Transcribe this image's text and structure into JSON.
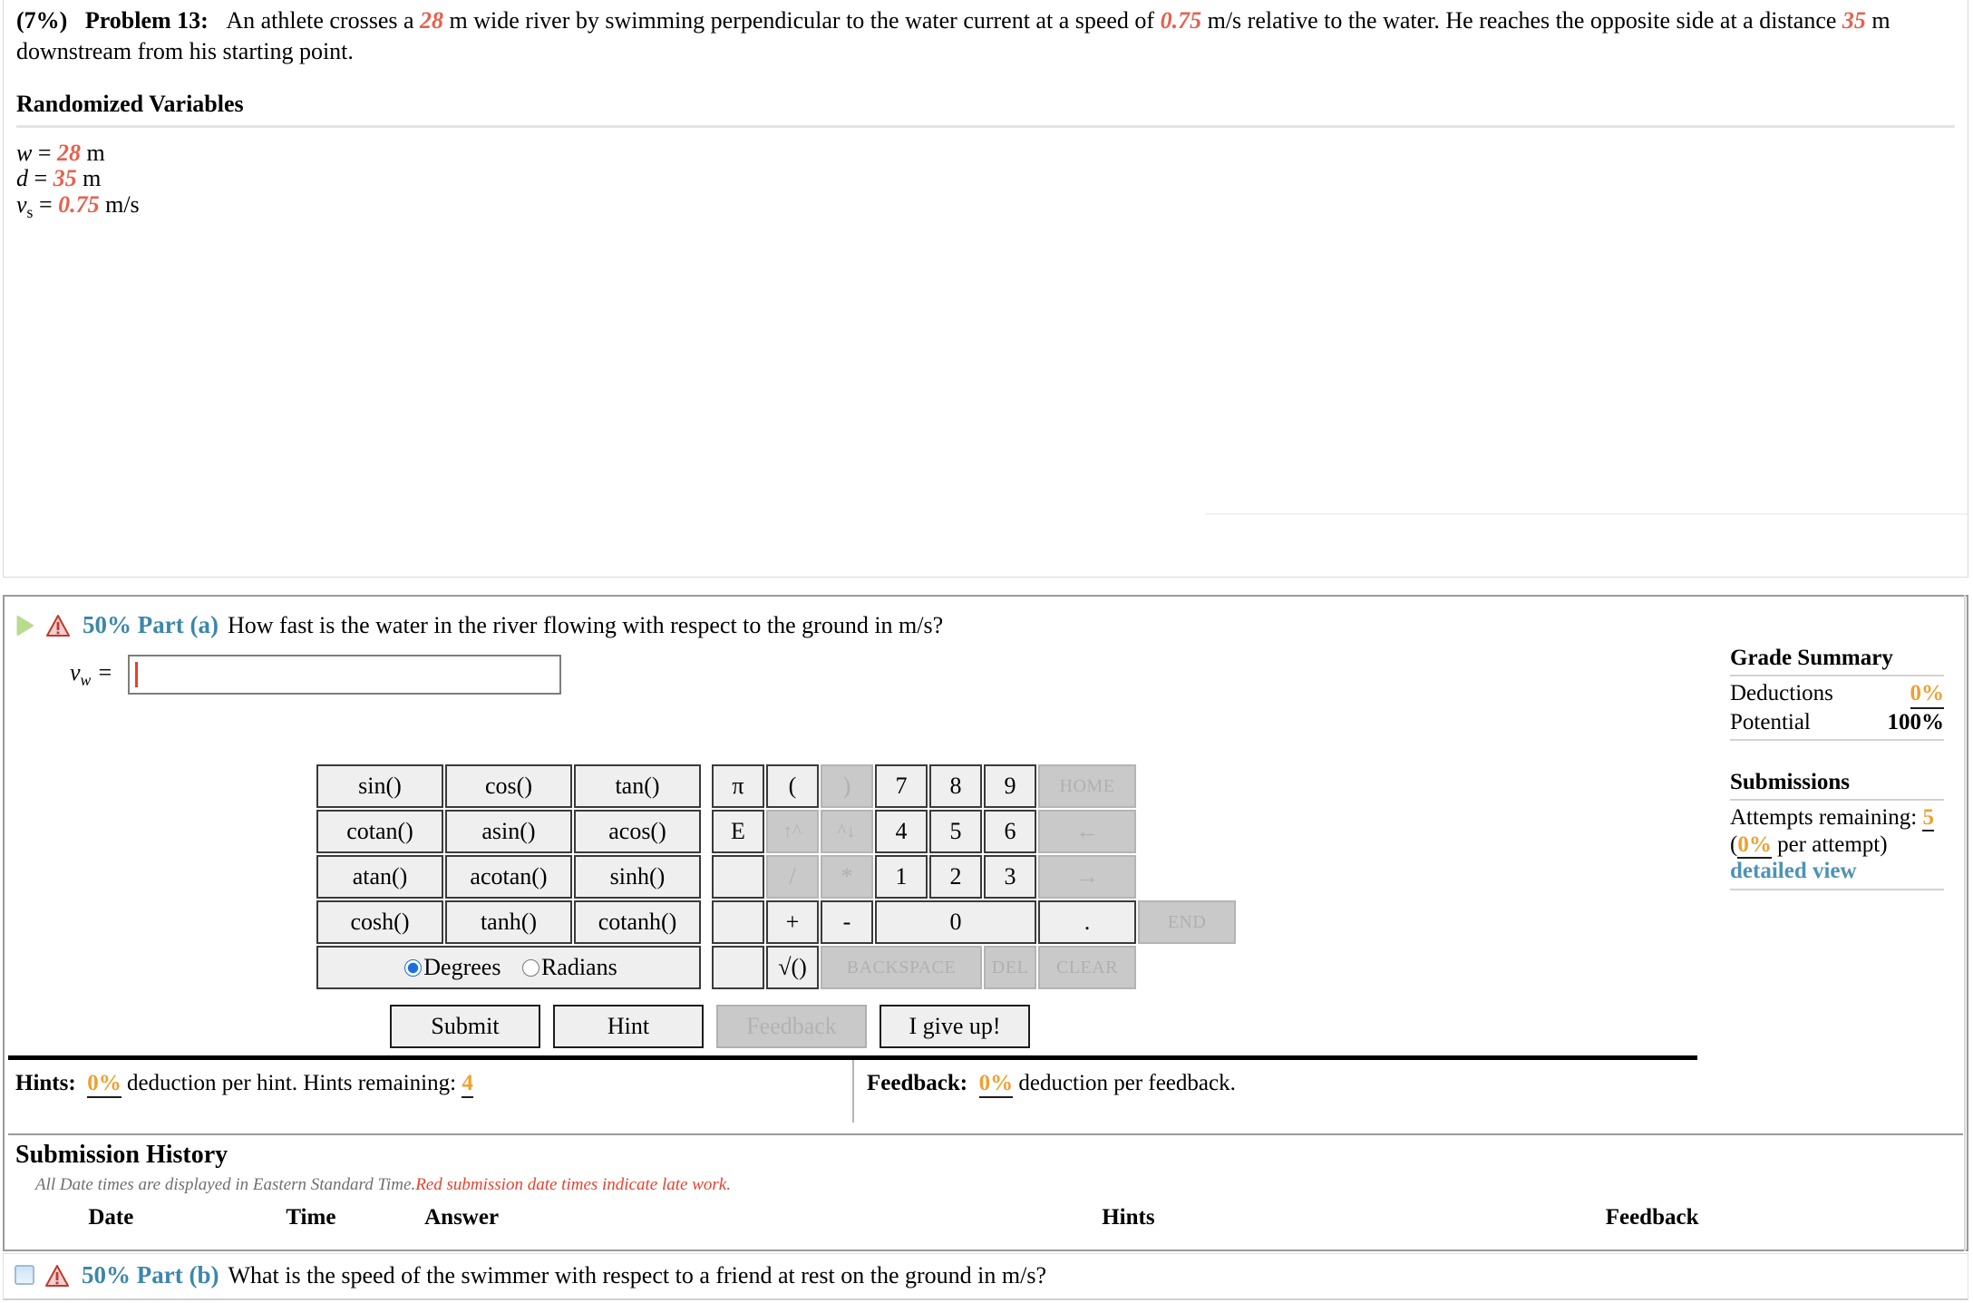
{
  "problem": {
    "percent": "(7%)",
    "label": "Problem 13:",
    "text_1": "An athlete crosses a ",
    "val_width": "28",
    "text_2": " m wide river by swimming perpendicular to the water current at a speed of ",
    "val_speed": "0.75",
    "text_3": " m/s relative to the water. He reaches the opposite side at a distance ",
    "val_dist": "35",
    "text_4": " m downstream from his starting point."
  },
  "randomized": {
    "heading": "Randomized Variables",
    "rows": [
      {
        "sym": "w",
        "sub": "",
        "eq": " = ",
        "val": "28",
        "unit": " m"
      },
      {
        "sym": "d",
        "sub": "",
        "eq": " = ",
        "val": "35",
        "unit": " m"
      },
      {
        "sym": "v",
        "sub": "s",
        "eq": " = ",
        "val": "0.75",
        "unit": " m/s"
      }
    ]
  },
  "part_a": {
    "icon_play": "play-icon",
    "icon_warning": "warning-icon",
    "percent": "50% Part (a)",
    "question": "How fast is the water in the river flowing with respect to the ground in m/s?",
    "answer_label_sym": "v",
    "answer_label_sub": "w",
    "answer_label_eq": " = ",
    "answer_value": "",
    "answer_placeholder": ""
  },
  "keypad": {
    "functions": [
      [
        "sin()",
        "cos()",
        "tan()"
      ],
      [
        "cotan()",
        "asin()",
        "acos()"
      ],
      [
        "atan()",
        "acotan()",
        "sinh()"
      ],
      [
        "cosh()",
        "tanh()",
        "cotanh()"
      ]
    ],
    "angle_modes": [
      {
        "label": "Degrees",
        "selected": true
      },
      {
        "label": "Radians",
        "selected": false
      }
    ],
    "rows": [
      [
        {
          "label": "π",
          "name": "pi-key",
          "enabled": true,
          "span": 1,
          "cls": ""
        },
        {
          "label": "(",
          "name": "open-paren-key",
          "enabled": true,
          "span": 1,
          "cls": ""
        },
        {
          "label": ")",
          "name": "close-paren-key",
          "enabled": false,
          "span": 1,
          "cls": ""
        },
        {
          "label": "7",
          "name": "key-7",
          "enabled": true,
          "span": 1,
          "cls": "num"
        },
        {
          "label": "8",
          "name": "key-8",
          "enabled": true,
          "span": 1,
          "cls": "num"
        },
        {
          "label": "9",
          "name": "key-9",
          "enabled": true,
          "span": 1,
          "cls": "num"
        },
        {
          "label": "HOME",
          "name": "home-key",
          "enabled": false,
          "span": 1,
          "cls": "home small"
        }
      ],
      [
        {
          "label": "E",
          "name": "exponent-key",
          "enabled": true,
          "span": 1,
          "cls": ""
        },
        {
          "label": "↑^",
          "name": "superscript-key",
          "enabled": false,
          "span": 1,
          "cls": "small"
        },
        {
          "label": "^↓",
          "name": "subscript-key",
          "enabled": false,
          "span": 1,
          "cls": "small"
        },
        {
          "label": "4",
          "name": "key-4",
          "enabled": true,
          "span": 1,
          "cls": "num"
        },
        {
          "label": "5",
          "name": "key-5",
          "enabled": true,
          "span": 1,
          "cls": "num"
        },
        {
          "label": "6",
          "name": "key-6",
          "enabled": true,
          "span": 1,
          "cls": "num"
        },
        {
          "label": "←",
          "name": "arrow-left-key",
          "enabled": false,
          "span": 1,
          "cls": "home"
        }
      ],
      [
        {
          "label": "",
          "name": "blank-key-1",
          "enabled": true,
          "span": 1,
          "cls": "blank"
        },
        {
          "label": "/",
          "name": "divide-key",
          "enabled": false,
          "span": 1,
          "cls": ""
        },
        {
          "label": "*",
          "name": "multiply-key",
          "enabled": false,
          "span": 1,
          "cls": ""
        },
        {
          "label": "1",
          "name": "key-1",
          "enabled": true,
          "span": 1,
          "cls": "num"
        },
        {
          "label": "2",
          "name": "key-2",
          "enabled": true,
          "span": 1,
          "cls": "num"
        },
        {
          "label": "3",
          "name": "key-3",
          "enabled": true,
          "span": 1,
          "cls": "num"
        },
        {
          "label": "→",
          "name": "arrow-right-key",
          "enabled": false,
          "span": 1,
          "cls": "home"
        }
      ],
      [
        {
          "label": "",
          "name": "blank-key-2",
          "enabled": true,
          "span": 1,
          "cls": "blank"
        },
        {
          "label": "+",
          "name": "plus-key",
          "enabled": true,
          "span": 1,
          "cls": ""
        },
        {
          "label": "-",
          "name": "minus-key",
          "enabled": true,
          "span": 1,
          "cls": ""
        },
        {
          "label": "0",
          "name": "key-0",
          "enabled": true,
          "span": 3,
          "cls": ""
        },
        {
          "label": ".",
          "name": "decimal-key",
          "enabled": true,
          "span": 1,
          "cls": "num"
        },
        {
          "label": "END",
          "name": "end-key",
          "enabled": false,
          "span": 1,
          "cls": "home small"
        }
      ],
      [
        {
          "label": "",
          "name": "blank-key-3",
          "enabled": true,
          "span": 1,
          "cls": "blank"
        },
        {
          "label": "√()",
          "name": "sqrt-key",
          "enabled": true,
          "span": 1,
          "cls": ""
        },
        {
          "label": "BACKSPACE",
          "name": "backspace-key",
          "enabled": false,
          "span": 3,
          "cls": "small"
        },
        {
          "label": "DEL",
          "name": "delete-key",
          "enabled": false,
          "span": 1,
          "cls": "small"
        },
        {
          "label": "CLEAR",
          "name": "clear-key",
          "enabled": false,
          "span": 1,
          "cls": "home small"
        }
      ]
    ]
  },
  "actions": [
    {
      "label": "Submit",
      "name": "submit-button",
      "enabled": true
    },
    {
      "label": "Hint",
      "name": "hint-button",
      "enabled": true
    },
    {
      "label": "Feedback",
      "name": "feedback-button",
      "enabled": false
    },
    {
      "label": "I give up!",
      "name": "give-up-button",
      "enabled": true
    }
  ],
  "hints_strip": {
    "hints_title": "Hints:",
    "hints_pct": "0%",
    "hints_text": " deduction per hint. Hints remaining: ",
    "hints_remaining": "4",
    "feedback_title": "Feedback:",
    "feedback_pct": "0%",
    "feedback_text": " deduction per feedback."
  },
  "submission_history": {
    "title": "Submission History",
    "note_normal": "All Date times are displayed in Eastern Standard Time.",
    "note_late": "Red submission date times indicate late work.",
    "columns": [
      "Date",
      "Time",
      "Answer",
      "Hints",
      "Feedback"
    ],
    "rows": []
  },
  "grade_summary": {
    "title": "Grade Summary",
    "deductions_label": "Deductions",
    "deductions_value": "0%",
    "potential_label": "Potential",
    "potential_value": "100%",
    "submissions_title": "Submissions",
    "attempts_label": "Attempts remaining: ",
    "attempts_value": "5",
    "per_attempt_open": "(",
    "per_attempt_value": "0%",
    "per_attempt_text": " per attempt)",
    "detailed_view": "detailed view"
  },
  "part_b": {
    "icon_collapsed": "collapsed-box-icon",
    "icon_warning": "warning-icon",
    "percent": "50% Part (b)",
    "question": "What is the speed of the swimmer with respect to a friend at rest on the ground in m/s?"
  },
  "colors": {
    "randomized_value": "#e8604c",
    "part_heading": "#3c87ab",
    "tooltip_orange": "#f0a030",
    "late_red": "#e8402c",
    "link_blue": "#4d93b5"
  }
}
